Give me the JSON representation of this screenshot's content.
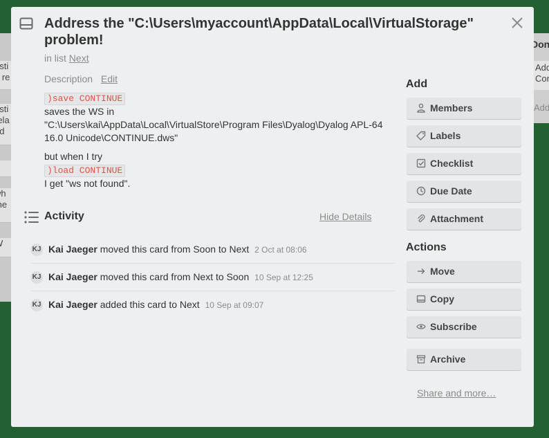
{
  "background": {
    "left_cards": [
      "esti",
      "n re",
      "esti",
      "rela",
      "nd",
      "",
      "wh",
      "the",
      "W"
    ],
    "right_list_title": "Don",
    "right_card": "Add Con",
    "right_add": "Add"
  },
  "card": {
    "title": "Address the \"C:\\Users\\myaccount\\AppData\\Local\\VirtualStorage\" problem!",
    "in_list_prefix": "in list",
    "list_name": "Next"
  },
  "description": {
    "heading": "Description",
    "edit_label": "Edit",
    "code1": ")save CONTINUE",
    "line1": "saves the WS in",
    "line2": "\"C:\\Users\\kai\\AppData\\Local\\VirtualStore\\Program Files\\Dyalog\\Dyalog APL-64 16.0 Unicode\\CONTINUE.dws\"",
    "line3": "but when I try",
    "code2": ")load CONTINUE",
    "line4": "I get \"ws not found\"."
  },
  "activity": {
    "title": "Activity",
    "hide_details": "Hide Details",
    "items": [
      {
        "initials": "KJ",
        "user": "Kai Jaeger",
        "action": "moved this card from Soon to Next",
        "date": "2 Oct at 08:06"
      },
      {
        "initials": "KJ",
        "user": "Kai Jaeger",
        "action": "moved this card from Next to Soon",
        "date": "10 Sep at 12:25"
      },
      {
        "initials": "KJ",
        "user": "Kai Jaeger",
        "action": "added this card to Next",
        "date": "10 Sep at 09:07"
      }
    ]
  },
  "sidebar": {
    "add_heading": "Add",
    "add_buttons": [
      "Members",
      "Labels",
      "Checklist",
      "Due Date",
      "Attachment"
    ],
    "actions_heading": "Actions",
    "action_buttons": [
      "Move",
      "Copy",
      "Subscribe",
      "Archive"
    ],
    "share_label": "Share and more…"
  },
  "icons": {
    "card": "card-icon",
    "close": "close-icon",
    "activity": "activity-list-icon",
    "members": "person-icon",
    "labels": "tag-icon",
    "checklist": "checkbox-icon",
    "due_date": "clock-icon",
    "attachment": "paperclip-icon",
    "move": "arrow-right-icon",
    "copy": "copy-icon",
    "subscribe": "eye-icon",
    "archive": "archive-icon"
  }
}
